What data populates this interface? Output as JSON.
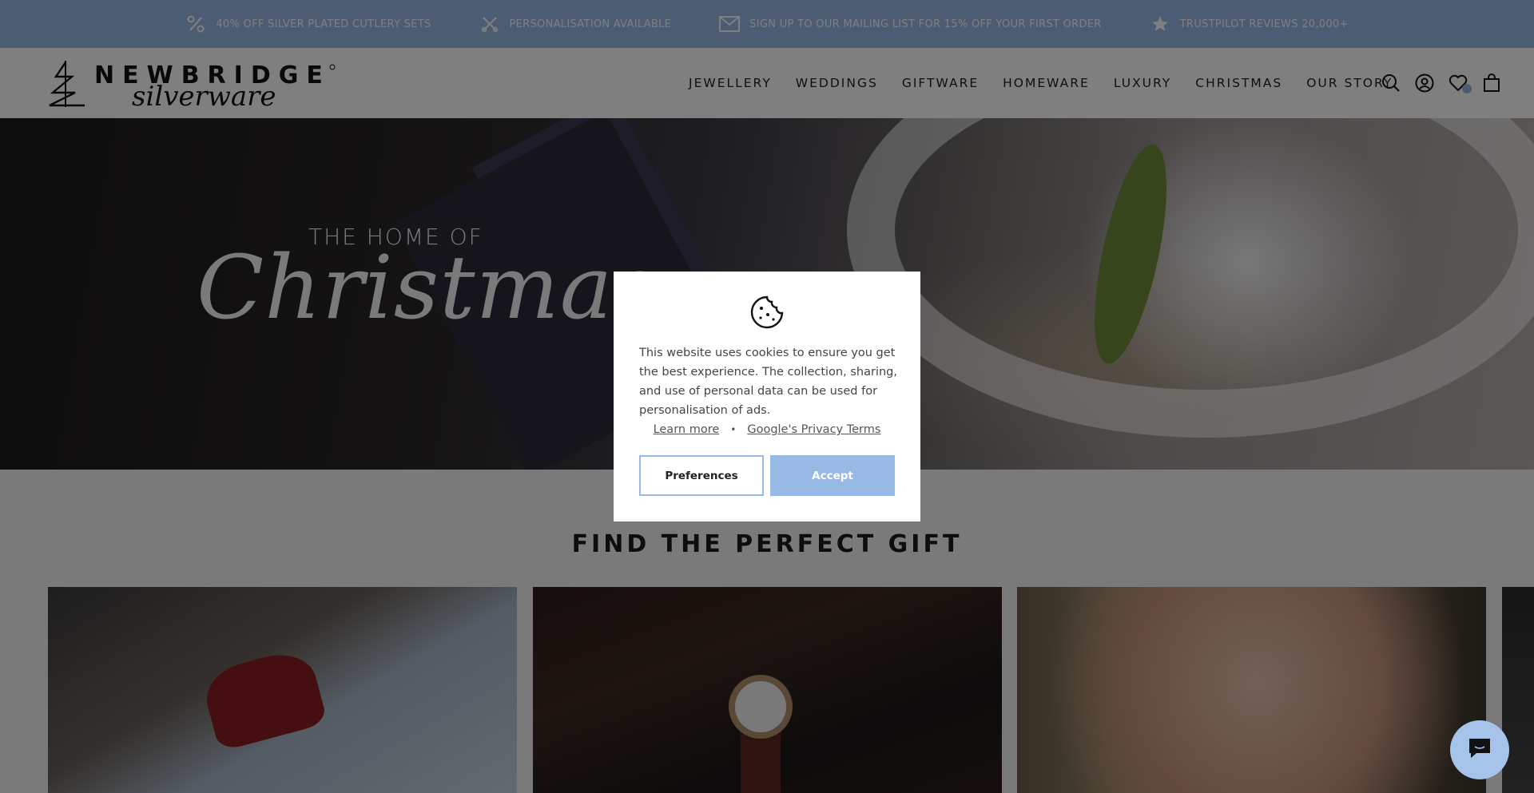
{
  "announcement": {
    "items": [
      {
        "icon": "percent-icon",
        "text": "40% OFF SILVER PLATED CUTLERY SETS"
      },
      {
        "icon": "scissors-icon",
        "text": "PERSONALISATION AVAILABLE"
      },
      {
        "icon": "envelope-icon",
        "text": "SIGN UP TO OUR MAILING LIST FOR 15% OFF YOUR FIRST ORDER"
      },
      {
        "icon": "star-icon",
        "text": "TRUSTPILOT REVIEWS 20,000+"
      }
    ]
  },
  "header": {
    "logo": {
      "line1": "NEWBRIDGE",
      "line2": "silverware"
    },
    "nav": [
      "JEWELLERY",
      "WEDDINGS",
      "GIFTWARE",
      "HOMEWARE",
      "LUXURY",
      "CHRISTMAS",
      "OUR STORY"
    ],
    "icons": [
      "search-icon",
      "account-icon",
      "wishlist-icon",
      "bag-icon"
    ]
  },
  "hero": {
    "subtitle": "THE HOME OF",
    "title": "Christmas"
  },
  "gift_section": {
    "heading": "FIND THE PERFECT GIFT"
  },
  "cookie_modal": {
    "message": "This website uses cookies to ensure you get the best experience. The collection, sharing, and use of personal data can be used for personalisation of ads.",
    "learn_more": "Learn more",
    "separator": "•",
    "privacy_terms": "Google's Privacy Terms",
    "preferences_label": "Preferences",
    "accept_label": "Accept"
  },
  "colors": {
    "accent": "#98b9e4",
    "overlay": "rgba(0,0,0,0.5)"
  }
}
